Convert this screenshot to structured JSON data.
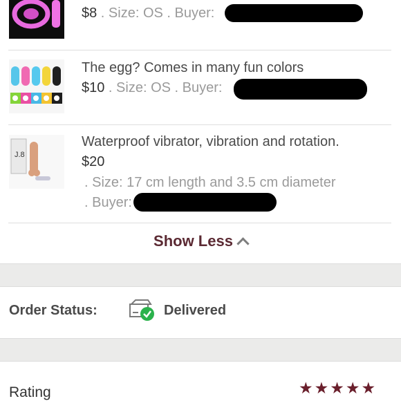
{
  "items": [
    {
      "title": "",
      "price": "$8",
      "meta": " . Size: OS . Buyer:",
      "thumb_icon": "pink-ring-vibrator-image"
    },
    {
      "title": "The egg? Comes in many fun colors",
      "price": "$10",
      "meta": " . Size: OS . Buyer:",
      "thumb_icon": "colorful-eggs-image"
    },
    {
      "title": "Waterproof vibrator, vibration and rotation.",
      "price": "$20",
      "size_line": ". Size: 17 cm length and 3.5 cm diameter",
      "buyer_line": ". Buyer:",
      "thumb_icon": "vibrator-box-image"
    }
  ],
  "show_less": "Show Less",
  "order_status": {
    "label": "Order Status:",
    "value": "Delivered",
    "icon": "box-delivered-check-icon"
  },
  "rating": {
    "label": "Rating",
    "stars": "★★★★★",
    "value": 5,
    "color": "#6a1f2c"
  },
  "colors": {
    "accent": "#5b2a33",
    "check": "#2bb24c"
  }
}
